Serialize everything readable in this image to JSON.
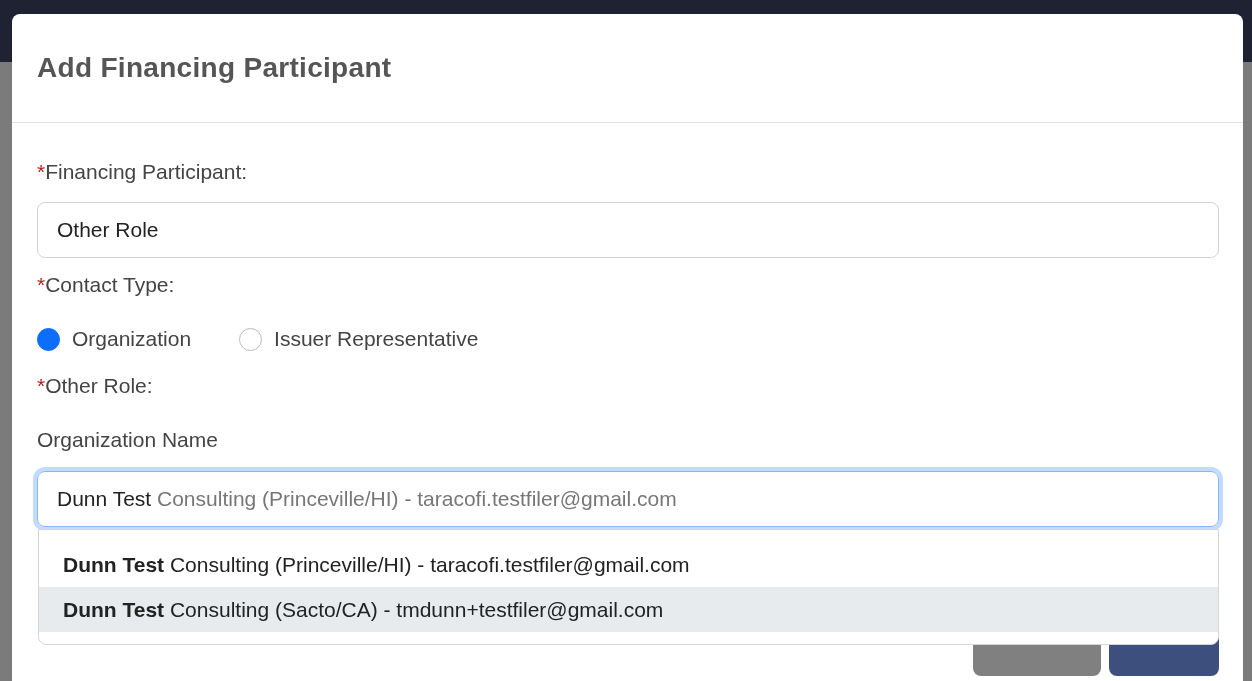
{
  "dialog": {
    "title": "Add Financing Participant"
  },
  "financing_participant": {
    "required_mark": "*",
    "label": "Financing Participant:",
    "value": "Other Role"
  },
  "contact_type": {
    "required_mark": "*",
    "label": "Contact Type:",
    "options": [
      {
        "label": "Organization",
        "selected": true
      },
      {
        "label": "Issuer Representative",
        "selected": false
      }
    ]
  },
  "other_role": {
    "required_mark": "*",
    "label": "Other Role:"
  },
  "organization_name": {
    "label": "Organization Name",
    "value": "Dunn Test",
    "completion_hint": " Consulting (Princeville/HI) - taracofi.testfiler@gmail.com",
    "focused": true,
    "suggestions": [
      {
        "text": "**Dunn Test** Consulting (Princeville/HI) - taracofi.testfiler@gmail.com",
        "selected": false
      },
      {
        "text": "**Dunn Test** Consulting (Sacto/CA) - tmdunn+testfiler@gmail.com",
        "selected": true
      }
    ]
  },
  "buttons": [
    {
      "kind": "secondary"
    },
    {
      "kind": "primary"
    }
  ]
}
